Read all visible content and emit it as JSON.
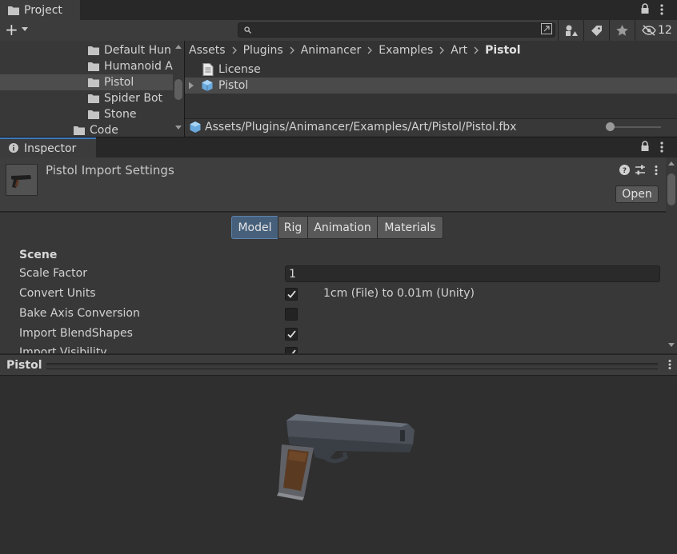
{
  "project": {
    "tab_label": "Project",
    "add_label": "+",
    "hidden_count": "12",
    "tree": [
      {
        "label": "Default Hun"
      },
      {
        "label": "Humanoid A"
      },
      {
        "label": "Pistol"
      },
      {
        "label": "Spider Bot"
      },
      {
        "label": "Stone"
      },
      {
        "label": "Code"
      }
    ],
    "breadcrumb": [
      "Assets",
      "Plugins",
      "Animancer",
      "Examples",
      "Art",
      "Pistol"
    ],
    "assets": [
      {
        "label": "License",
        "icon": "text-file-icon"
      },
      {
        "label": "Pistol",
        "icon": "model-prefab-icon"
      }
    ],
    "path": "Assets/Plugins/Animancer/Examples/Art/Pistol/Pistol.fbx"
  },
  "inspector": {
    "tab_label": "Inspector",
    "title": "Pistol Import Settings",
    "open_label": "Open",
    "tabs": [
      {
        "label": "Model",
        "active": true
      },
      {
        "label": "Rig",
        "active": false
      },
      {
        "label": "Animation",
        "active": false
      },
      {
        "label": "Materials",
        "active": false
      }
    ],
    "section": "Scene",
    "properties": {
      "scale_factor": {
        "label": "Scale Factor",
        "value": "1"
      },
      "convert_units": {
        "label": "Convert Units",
        "checked": true,
        "note": "1cm (File) to 0.01m (Unity)"
      },
      "bake_axis": {
        "label": "Bake Axis Conversion",
        "checked": false
      },
      "import_blendshapes": {
        "label": "Import BlendShapes",
        "checked": true
      },
      "import_visibility": {
        "label": "Import Visibility",
        "checked": true
      }
    }
  },
  "preview": {
    "title": "Pistol"
  },
  "colors": {
    "accent": "#3a79bb",
    "active_tab": "#46607c"
  }
}
